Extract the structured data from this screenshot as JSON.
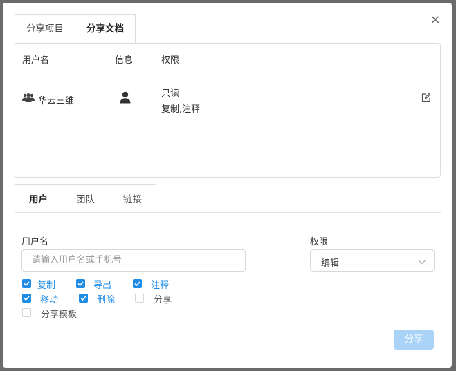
{
  "dialog": {
    "close_glyph": "×",
    "top_tabs": [
      {
        "label": "分享项目"
      },
      {
        "label": "分享文档"
      }
    ],
    "table": {
      "headers": {
        "user": "用户名",
        "info": "信息",
        "permission": "权限"
      },
      "row": {
        "name": "华云三维",
        "permission_level": "只读",
        "permission_detail": "复制,注释"
      }
    },
    "bottom_tabs": [
      {
        "label": "用户"
      },
      {
        "label": "团队"
      },
      {
        "label": "链接"
      }
    ],
    "form": {
      "user_label": "用户名",
      "user_placeholder": "请输入用户名或手机号",
      "permission_label": "权限",
      "permission_value": "编辑",
      "checkboxes": [
        {
          "label": "复制",
          "checked": true
        },
        {
          "label": "导出",
          "checked": true
        },
        {
          "label": "注释",
          "checked": true
        },
        {
          "label": "移动",
          "checked": true
        },
        {
          "label": "删除",
          "checked": true
        },
        {
          "label": "分享",
          "checked": false
        },
        {
          "label": "分享模板",
          "checked": false
        }
      ],
      "submit_label": "分享"
    },
    "colors": {
      "accent": "#1f8ce6",
      "disabled_button": "#a9d3f7",
      "overlay": "#6b6b6b"
    }
  }
}
